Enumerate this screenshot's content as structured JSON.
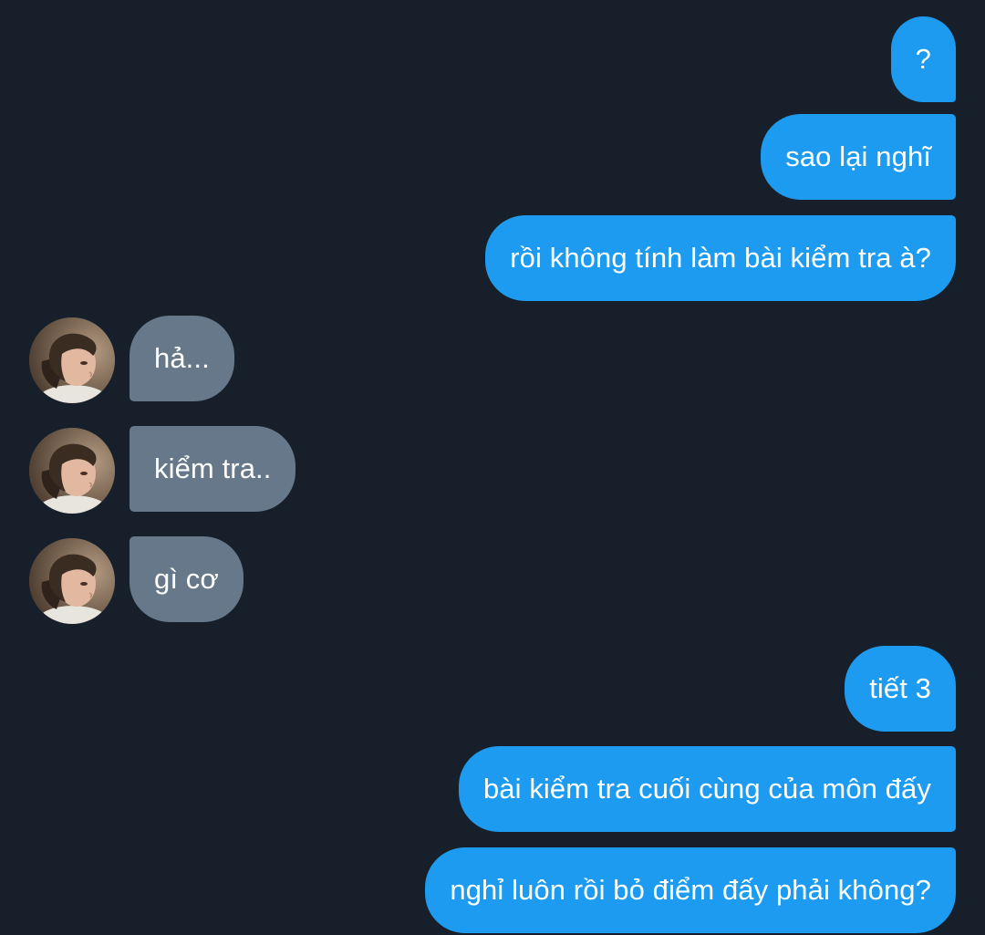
{
  "conversation": {
    "messages": [
      {
        "sender": "me",
        "text": "?"
      },
      {
        "sender": "me",
        "text": "sao lại nghĩ"
      },
      {
        "sender": "me",
        "text": "rồi không tính làm bài kiểm tra à?"
      },
      {
        "sender": "them",
        "text": "hả..."
      },
      {
        "sender": "them",
        "text": "kiểm tra.."
      },
      {
        "sender": "them",
        "text": "gì cơ"
      },
      {
        "sender": "me",
        "text": "tiết 3"
      },
      {
        "sender": "me",
        "text": "bài kiểm tra cuối cùng của môn đấy"
      },
      {
        "sender": "me",
        "text": "nghỉ luôn rồi bỏ điểm đấy phải không?"
      }
    ]
  },
  "colors": {
    "background": "#17202a",
    "outgoing_bubble": "#1d9bf0",
    "incoming_bubble": "#66788a",
    "text": "#ffffff"
  },
  "icons": {
    "contact_avatar": "profile-photo-avatar"
  }
}
